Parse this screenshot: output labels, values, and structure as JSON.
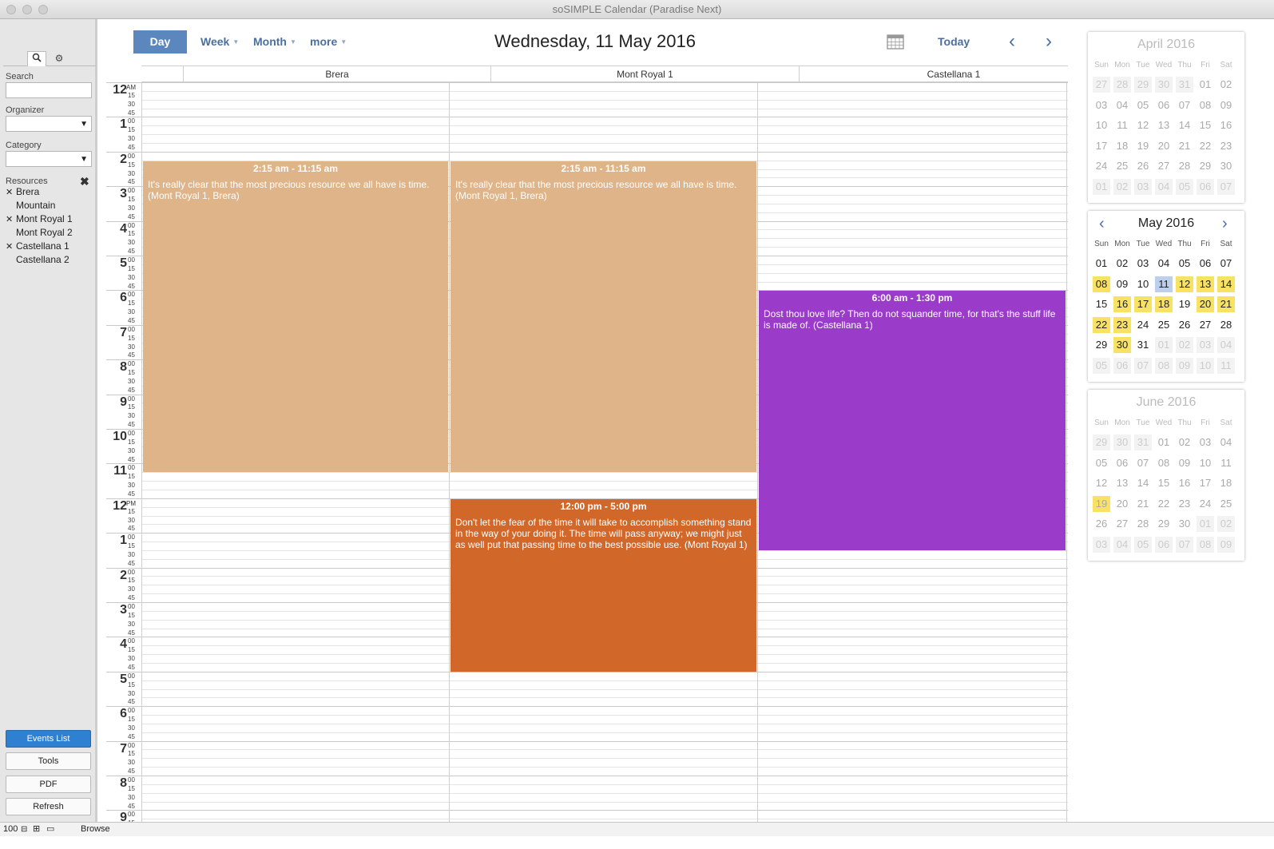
{
  "window": {
    "title": "soSIMPLE Calendar (Paradise Next)"
  },
  "sidebar": {
    "search_label": "Search",
    "organizer_label": "Organizer",
    "category_label": "Category",
    "resources_label": "Resources",
    "resources": [
      {
        "name": "Brera",
        "checked": true
      },
      {
        "name": "Mountain",
        "checked": false
      },
      {
        "name": "Mont Royal 1",
        "checked": true
      },
      {
        "name": "Mont Royal 2",
        "checked": false
      },
      {
        "name": "Castellana 1",
        "checked": true
      },
      {
        "name": "Castellana 2",
        "checked": false
      }
    ],
    "buttons": {
      "events_list": "Events List",
      "tools": "Tools",
      "pdf": "PDF",
      "refresh": "Refresh"
    }
  },
  "toolbar": {
    "day": "Day",
    "week": "Week",
    "month": "Month",
    "more": "more",
    "title": "Wednesday, 11 May 2016",
    "today": "Today"
  },
  "columns": [
    "Brera",
    "Mont Royal 1",
    "Castellana 1"
  ],
  "hour_labels": [
    "12",
    "1",
    "2",
    "3",
    "4",
    "5",
    "6",
    "7",
    "8",
    "9",
    "10",
    "11",
    "12",
    "1",
    "2",
    "3",
    "4",
    "5",
    "6",
    "7",
    "8",
    "9"
  ],
  "ampm": {
    "am": "AM",
    "pm": "PM"
  },
  "minute_labels": [
    "00",
    "15",
    "30",
    "45"
  ],
  "events": [
    {
      "column": 0,
      "start": 2.25,
      "end": 11.25,
      "time": "2:15 am - 11:15 am",
      "text": "It's really clear that the most precious resource we all have is time. (Mont Royal 1, Brera)",
      "color": "#dfb489"
    },
    {
      "column": 1,
      "start": 2.25,
      "end": 11.25,
      "time": "2:15 am - 11:15 am",
      "text": "It's really clear that the most precious resource we all have is time. (Mont Royal 1, Brera)",
      "color": "#dfb489"
    },
    {
      "column": 1,
      "start": 12,
      "end": 17,
      "time": "12:00 pm - 5:00 pm",
      "text": "Don't let the fear of the time it will take to accomplish something stand in the way of your doing it. The time will pass anyway; we might just as well put that passing time to the best possible use. (Mont Royal 1)",
      "color": "#d2672a"
    },
    {
      "column": 2,
      "start": 6,
      "end": 13.5,
      "time": "6:00 am - 1:30 pm",
      "text": "Dost thou love life? Then do not squander time, for that's the stuff life is made of. (Castellana 1)",
      "color": "#9a3bc9"
    }
  ],
  "minicals": [
    {
      "title": "April 2016",
      "dim": true,
      "arrows": false,
      "weeks": [
        [
          "27",
          "28",
          "29",
          "30",
          "31",
          "01",
          "02"
        ],
        [
          "03",
          "04",
          "05",
          "06",
          "07",
          "08",
          "09"
        ],
        [
          "10",
          "11",
          "12",
          "13",
          "14",
          "15",
          "16"
        ],
        [
          "17",
          "18",
          "19",
          "20",
          "21",
          "22",
          "23"
        ],
        [
          "24",
          "25",
          "26",
          "27",
          "28",
          "29",
          "30"
        ],
        [
          "01",
          "02",
          "03",
          "04",
          "05",
          "06",
          "07"
        ]
      ],
      "first_other_row_cells": 5,
      "last_other_row": true,
      "highlights": []
    },
    {
      "title": "May 2016",
      "dim": false,
      "arrows": true,
      "weeks": [
        [
          "01",
          "02",
          "03",
          "04",
          "05",
          "06",
          "07"
        ],
        [
          "08",
          "09",
          "10",
          "11",
          "12",
          "13",
          "14"
        ],
        [
          "15",
          "16",
          "17",
          "18",
          "19",
          "20",
          "21"
        ],
        [
          "22",
          "23",
          "24",
          "25",
          "26",
          "27",
          "28"
        ],
        [
          "29",
          "30",
          "31",
          "01",
          "02",
          "03",
          "04"
        ],
        [
          "05",
          "06",
          "07",
          "08",
          "09",
          "10",
          "11"
        ]
      ],
      "highlights": [
        "1-0",
        "1-4",
        "1-5",
        "1-6",
        "2-1",
        "2-2",
        "2-3",
        "2-5",
        "2-6",
        "3-0",
        "3-1",
        "4-1"
      ],
      "today": "1-3"
    },
    {
      "title": "June 2016",
      "dim": true,
      "arrows": false,
      "weeks": [
        [
          "29",
          "30",
          "31",
          "01",
          "02",
          "03",
          "04"
        ],
        [
          "05",
          "06",
          "07",
          "08",
          "09",
          "10",
          "11"
        ],
        [
          "12",
          "13",
          "14",
          "15",
          "16",
          "17",
          "18"
        ],
        [
          "19",
          "20",
          "21",
          "22",
          "23",
          "24",
          "25"
        ],
        [
          "26",
          "27",
          "28",
          "29",
          "30",
          "01",
          "02"
        ],
        [
          "03",
          "04",
          "05",
          "06",
          "07",
          "08",
          "09"
        ]
      ],
      "highlights": [
        "3-0"
      ]
    }
  ],
  "dow": [
    "Sun",
    "Mon",
    "Tue",
    "Wed",
    "Thu",
    "Fri",
    "Sat"
  ],
  "status": {
    "zoom": "100",
    "mode": "Browse"
  }
}
